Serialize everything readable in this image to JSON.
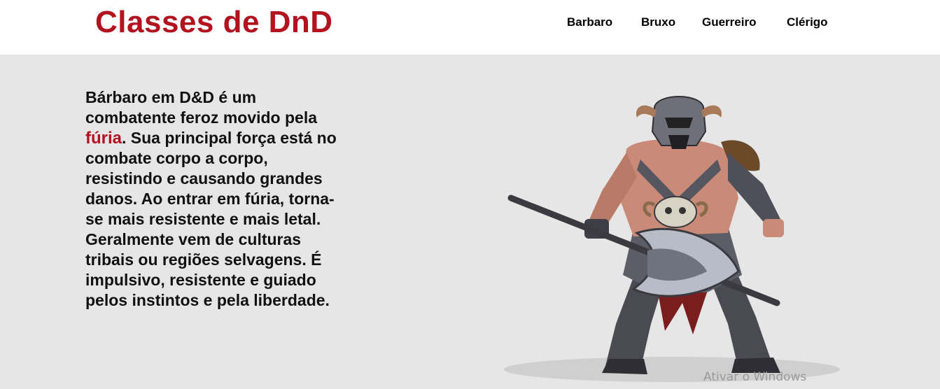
{
  "header": {
    "title": "Classes de DnD",
    "nav": [
      "Barbaro",
      "Bruxo",
      "Guerreiro",
      "Clérigo"
    ]
  },
  "main": {
    "text_before": "Bárbaro em D&D é um combatente feroz movido pela ",
    "highlight": "fúria",
    "text_after": ". Sua principal força está no combate corpo a corpo, resistindo e causando grandes danos. Ao entrar em fúria, torna-se mais resistente e mais letal. Geralmente vem de culturas tribais ou regiões selvagens. É impulsivo, resistente e guiado pelos instintos e pela liberdade."
  },
  "hero_image": "barbarian-warrior-illustration",
  "watermark": "Ativar o Windows",
  "colors": {
    "accent": "#b3121f",
    "header_bg": "#ffffff",
    "page_bg": "#e6e6e6"
  }
}
